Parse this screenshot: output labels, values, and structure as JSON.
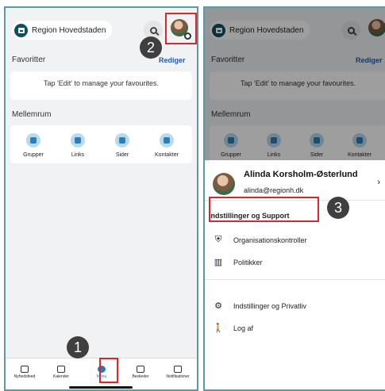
{
  "left_screen": {
    "org_label": "Region Hovedstaden",
    "favorites": {
      "title": "Favoritter",
      "edit": "Rediger",
      "hint": "Tap 'Edit' to manage your favourites."
    },
    "spaces": {
      "title": "Mellemrum",
      "tiles": [
        "Grupper",
        "Links",
        "Sider",
        "Kontakter"
      ]
    },
    "tabbar": [
      "Nyhedsfeed",
      "Kalender",
      "Menu",
      "Beskeder",
      "Notifikationer"
    ],
    "selected_tab": "Menu"
  },
  "right_screen": {
    "org_label": "Region Hovedstaden",
    "favorites": {
      "title": "Favoritter",
      "edit": "Rediger",
      "hint": "Tap 'Edit' to manage your favourites."
    },
    "spaces": {
      "title": "Mellemrum",
      "tiles": [
        "Grupper",
        "Links",
        "Sider",
        "Kontakter"
      ]
    },
    "profile": {
      "name": "Alinda Korsholm-Østerlund",
      "email": "alinda@regionh.dk"
    },
    "menu": [
      {
        "label": "Indstillinger og Support",
        "icon": "none"
      },
      {
        "label": "Organisationskontroller",
        "icon": "shield-icon"
      },
      {
        "label": "Politikker",
        "icon": "book-icon"
      },
      {
        "label": "Indstillinger og Privatliv",
        "icon": "gear-icon"
      },
      {
        "label": "Log af",
        "icon": "walk-icon"
      }
    ]
  },
  "steps": [
    "1",
    "2",
    "3"
  ],
  "colors": {
    "highlight": "#d9272e",
    "accent": "#1a7cc8",
    "brand": "#0b5160",
    "frame": "#5e9aa0"
  }
}
